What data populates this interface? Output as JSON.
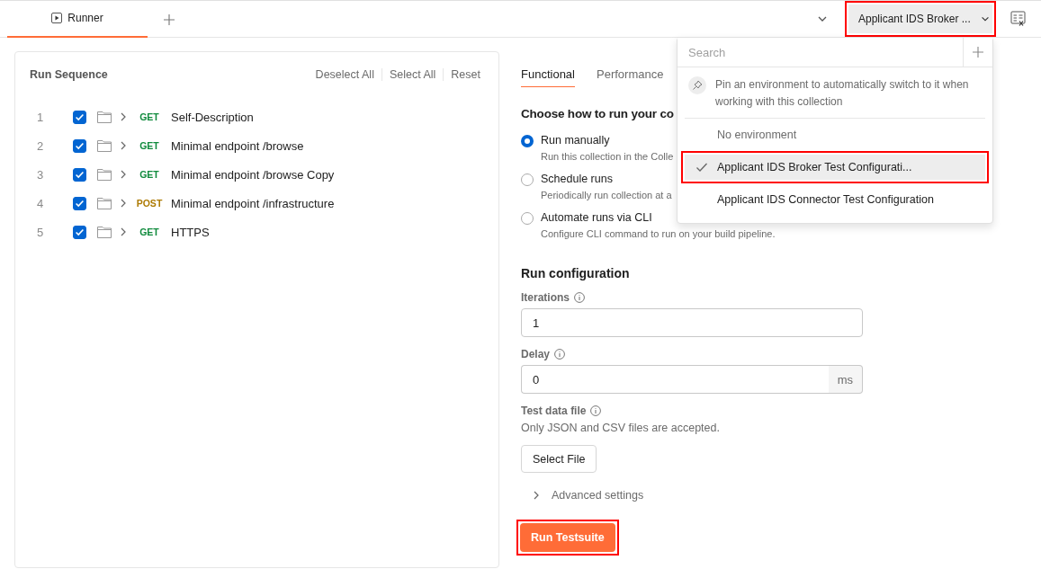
{
  "tabs": [
    {
      "label": "Runner",
      "selected": true
    }
  ],
  "environment": {
    "label": "Applicant IDS Broker ...",
    "highlighted": true
  },
  "run_sequence": {
    "title": "Run Sequence",
    "actions": [
      "Deselect All",
      "Select All",
      "Reset"
    ],
    "items": [
      {
        "number": "1",
        "checked": true,
        "method": "GET",
        "color": "#0f8a3c",
        "name": "Self-Description"
      },
      {
        "number": "2",
        "checked": true,
        "method": "GET",
        "color": "#0f8a3c",
        "name": "Minimal endpoint /browse"
      },
      {
        "number": "3",
        "checked": true,
        "method": "GET",
        "color": "#0f8a3c",
        "name": "Minimal endpoint /browse Copy"
      },
      {
        "number": "4",
        "checked": true,
        "method": "POST",
        "color": "#ad7a03",
        "name": "Minimal endpoint /infrastructure"
      },
      {
        "number": "5",
        "checked": true,
        "method": "GET",
        "color": "#0f8a3c",
        "name": "HTTPS"
      }
    ]
  },
  "mode_tabs": [
    {
      "label": "Functional",
      "selected": true
    },
    {
      "label": "Performance",
      "selected": false
    }
  ],
  "run_mode": {
    "heading": "Choose how to run your co",
    "options": [
      {
        "label": "Run manually",
        "description": "Run this collection in the Colle",
        "selected": true
      },
      {
        "label": "Schedule runs",
        "description": "Periodically run collection at a",
        "selected": false
      },
      {
        "label": "Automate runs via CLI",
        "description": "Configure CLI command to run on your build pipeline.",
        "selected": false
      }
    ]
  },
  "run_configuration": {
    "heading": "Run configuration",
    "iterations_label": "Iterations",
    "iterations": "1",
    "delay_label": "Delay",
    "delay": "0",
    "delay_unit": "ms",
    "test_data_label": "Test data file",
    "test_data_hint": "Only JSON and CSV files are accepted.",
    "select_file": "Select File",
    "advanced": "Advanced settings",
    "run_button": "Run Testsuite",
    "run_highlighted": true
  },
  "environment_menu": {
    "placeholder": "Search",
    "pin_hint": "Pin an environment to automatically switch to it when working with this collection",
    "items": [
      {
        "label": "No environment",
        "selected": false,
        "highlighted": false
      },
      {
        "label": "Applicant IDS Broker Test Configurati...",
        "selected": true,
        "highlighted": true
      },
      {
        "label": "Applicant IDS Connector Test Configuration",
        "selected": false,
        "highlighted": false
      }
    ]
  }
}
